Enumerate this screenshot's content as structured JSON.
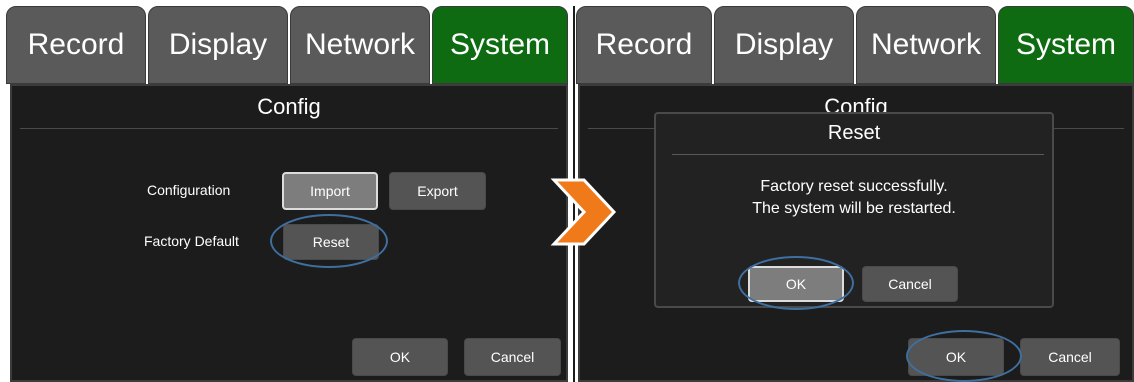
{
  "left": {
    "tabs": [
      "Record",
      "Display",
      "Network",
      "System"
    ],
    "screen_title": "Config",
    "configuration_label": "Configuration",
    "import_label": "Import",
    "export_label": "Export",
    "factory_default_label": "Factory Default",
    "reset_label": "Reset",
    "ok_label": "OK",
    "cancel_label": "Cancel"
  },
  "right": {
    "tabs": [
      "Record",
      "Display",
      "Network",
      "System"
    ],
    "screen_title": "Config",
    "dialog": {
      "title": "Reset",
      "message_line1": "Factory reset successfully.",
      "message_line2": "The system will be restarted.",
      "ok_label": "OK",
      "cancel_label": "Cancel"
    },
    "ok_label": "OK",
    "cancel_label": "Cancel"
  },
  "colors": {
    "active_tab": "#0e6b12",
    "tab": "#5a5a5a",
    "highlight_ring": "#3e6f9e",
    "arrow": "#f07a1a"
  },
  "active_tab": "System"
}
